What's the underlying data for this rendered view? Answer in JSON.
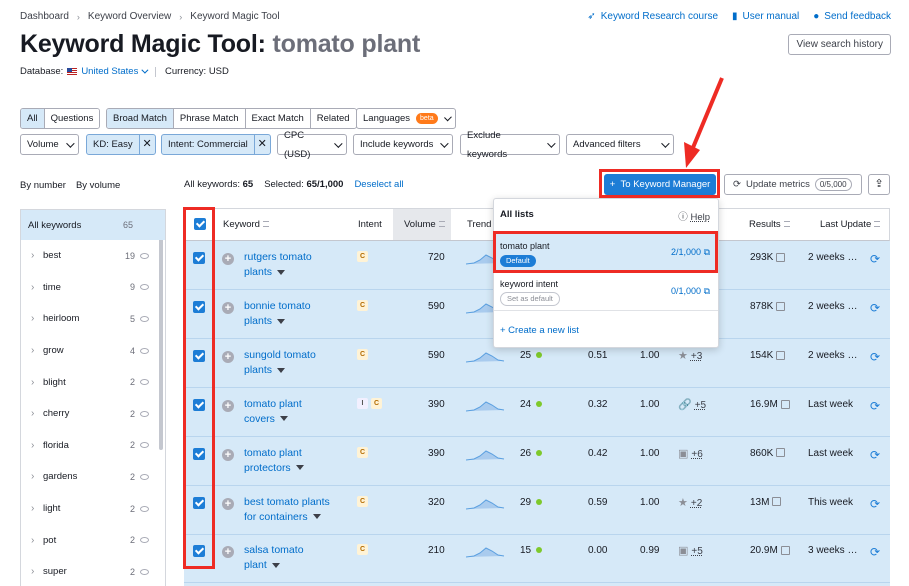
{
  "breadcrumb": [
    "Dashboard",
    "Keyword Overview",
    "Keyword Magic Tool"
  ],
  "top_links": [
    {
      "label": "Keyword Research course",
      "icon": "graduation-icon"
    },
    {
      "label": "User manual",
      "icon": "book-icon"
    },
    {
      "label": "Send feedback",
      "icon": "chat-icon"
    }
  ],
  "title": {
    "tool": "Keyword Magic Tool:",
    "query": "tomato plant"
  },
  "view_history_label": "View search history",
  "database": {
    "label": "Database:",
    "value": "United States",
    "currency_label": "Currency: USD"
  },
  "filters": {
    "type_tabs": [
      "All",
      "Questions"
    ],
    "match_tabs": [
      "Broad Match",
      "Phrase Match",
      "Exact Match",
      "Related"
    ],
    "languages_label": "Languages",
    "beta_label": "beta",
    "row2": {
      "volume": "Volume",
      "kd_chip": "KD: Easy",
      "intent_chip": "Intent: Commercial",
      "cpc": "CPC (USD)",
      "include": "Include keywords",
      "exclude": "Exclude keywords",
      "advanced": "Advanced filters"
    }
  },
  "group_tabs": [
    "By number",
    "By volume"
  ],
  "groups": [
    {
      "name": "All keywords",
      "count": "65"
    },
    {
      "name": "best",
      "count": "19"
    },
    {
      "name": "time",
      "count": "9"
    },
    {
      "name": "heirloom",
      "count": "5"
    },
    {
      "name": "grow",
      "count": "4"
    },
    {
      "name": "blight",
      "count": "2"
    },
    {
      "name": "cherry",
      "count": "2"
    },
    {
      "name": "florida",
      "count": "2"
    },
    {
      "name": "gardens",
      "count": "2"
    },
    {
      "name": "light",
      "count": "2"
    },
    {
      "name": "pot",
      "count": "2"
    },
    {
      "name": "super",
      "count": "2"
    }
  ],
  "summary": {
    "all_label": "All keywords:",
    "all_value": "65",
    "selected_label": "Selected:",
    "selected_value": "65/1,000",
    "deselect_label": "Deselect all"
  },
  "actions": {
    "to_keyword_manager": "To Keyword Manager",
    "update_metrics": "Update metrics",
    "update_quota": "0/5,000"
  },
  "columns": {
    "keyword": "Keyword",
    "intent": "Intent",
    "volume": "Volume",
    "trend": "Trend",
    "results": "Results",
    "last_update": "Last Update"
  },
  "rows": [
    {
      "kw1": "rutgers tomato",
      "kw2": "plants",
      "intent": [
        "C"
      ],
      "volume": "720",
      "kd": "",
      "cpc": "",
      "com": "",
      "sf": "",
      "sfn": "",
      "results": "293K",
      "updated": "2 weeks …"
    },
    {
      "kw1": "bonnie tomato",
      "kw2": "plants",
      "intent": [
        "C"
      ],
      "volume": "590",
      "kd": "",
      "cpc": "",
      "com": "",
      "sf": "",
      "sfn": "",
      "results": "878K",
      "updated": "2 weeks …"
    },
    {
      "kw1": "sungold tomato",
      "kw2": "plants",
      "intent": [
        "C"
      ],
      "volume": "590",
      "kd": "25",
      "cpc": "0.51",
      "com": "1.00",
      "sf": "★",
      "sfn": "+3",
      "results": "154K",
      "updated": "2 weeks …"
    },
    {
      "kw1": "tomato plant",
      "kw2": "covers",
      "intent": [
        "I",
        "C"
      ],
      "volume": "390",
      "kd": "24",
      "cpc": "0.32",
      "com": "1.00",
      "sf": "🔗",
      "sfn": "+5",
      "results": "16.9M",
      "updated": "Last week"
    },
    {
      "kw1": "tomato plant",
      "kw2": "protectors",
      "intent": [
        "C"
      ],
      "volume": "390",
      "kd": "26",
      "cpc": "0.42",
      "com": "1.00",
      "sf": "▣",
      "sfn": "+6",
      "results": "860K",
      "updated": "Last week"
    },
    {
      "kw1": "best tomato plants",
      "kw2": "for containers",
      "intent": [
        "C"
      ],
      "volume": "320",
      "kd": "29",
      "cpc": "0.59",
      "com": "1.00",
      "sf": "★",
      "sfn": "+2",
      "results": "13M",
      "updated": "This week"
    },
    {
      "kw1": "salsa tomato",
      "kw2": "plant",
      "intent": [
        "C"
      ],
      "volume": "210",
      "kd": "15",
      "cpc": "0.00",
      "com": "0.99",
      "sf": "▣",
      "sfn": "+5",
      "results": "20.9M",
      "updated": "3 weeks …"
    }
  ],
  "popover": {
    "title": "All lists",
    "help": "Help",
    "lists": [
      {
        "name": "tomato plant",
        "badge": "Default",
        "count": "2/1,000"
      },
      {
        "name": "keyword intent",
        "badge": "Set as default",
        "count": "0/1,000"
      }
    ],
    "create": "+ Create a new list"
  },
  "colors": {
    "accent": "#1d7dd6",
    "selection": "#d6e9f8",
    "annotation": "#ee2b24"
  }
}
